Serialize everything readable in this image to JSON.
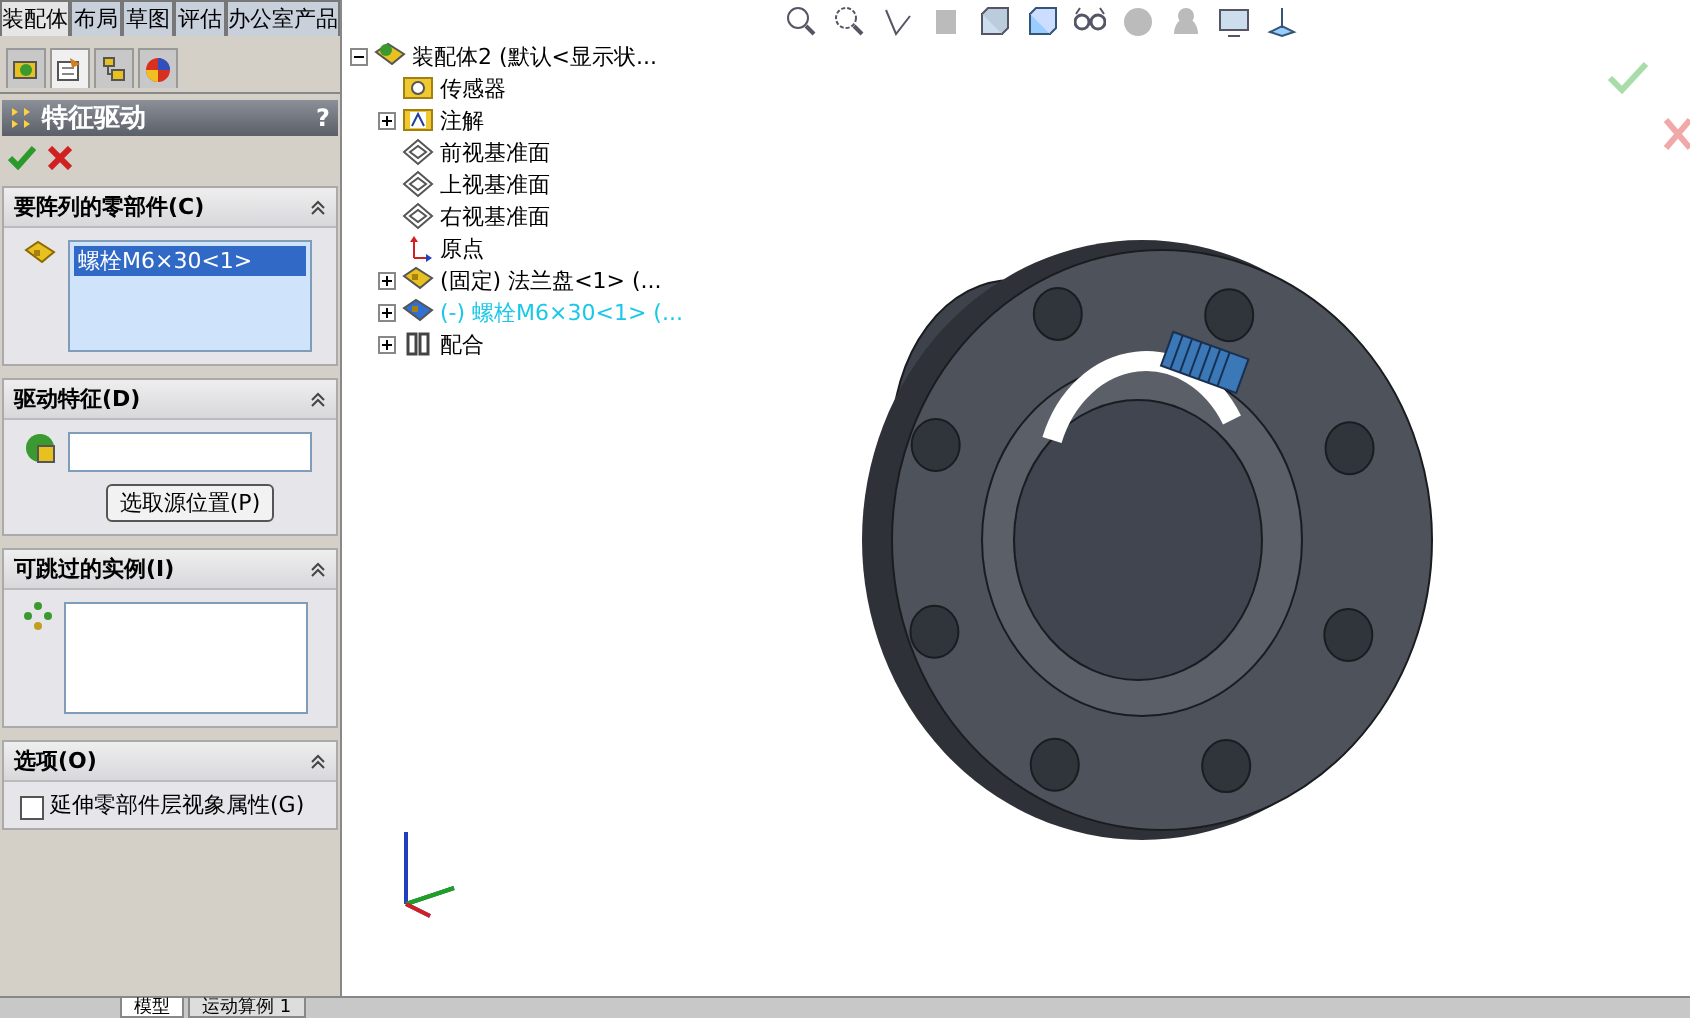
{
  "top_tabs": [
    {
      "label": "装配体",
      "selected": true
    },
    {
      "label": "布局",
      "selected": false
    },
    {
      "label": "草图",
      "selected": false
    },
    {
      "label": "评估",
      "selected": false
    },
    {
      "label": "办公室产品",
      "selected": false
    }
  ],
  "panel_tabs": [
    {
      "kind": "feature",
      "selected": false
    },
    {
      "kind": "property",
      "selected": true
    },
    {
      "kind": "config",
      "selected": false
    },
    {
      "kind": "appearance",
      "selected": false
    }
  ],
  "property_manager": {
    "title": "特征驱动",
    "help": "?"
  },
  "sections": [
    {
      "kind": "list",
      "title": "要阵列的零部件(C)",
      "items": [
        "螺栓M6×30<1>"
      ]
    },
    {
      "kind": "field",
      "title": "驱动特征(D)",
      "button": "选取源位置(P)"
    },
    {
      "kind": "list",
      "title": "可跳过的实例(I)"
    },
    {
      "kind": "checkbox",
      "title": "选项(O)",
      "label": "延伸零部件层视象属性(G)",
      "checked": false
    }
  ],
  "tree": {
    "label": "装配体2  (默认<显示状...",
    "kind": "assembly",
    "expanded": true,
    "children": [
      {
        "label": "传感器",
        "kind": "sensor"
      },
      {
        "label": "注解",
        "kind": "annotation",
        "expanded": false
      },
      {
        "label": "前视基准面",
        "kind": "plane"
      },
      {
        "label": "上视基准面",
        "kind": "plane"
      },
      {
        "label": "右视基准面",
        "kind": "plane"
      },
      {
        "label": "原点",
        "kind": "origin"
      },
      {
        "label": "(固定) 法兰盘<1> (...",
        "kind": "part",
        "expanded": false,
        "highlighted": false
      },
      {
        "label": "(-) 螺栓M6×30<1> (...",
        "kind": "part",
        "expanded": false,
        "highlighted": true
      },
      {
        "label": "配合",
        "kind": "mate",
        "expanded": false
      }
    ]
  },
  "bottom_tabs": [
    {
      "label": "模型",
      "selected": true
    },
    {
      "label": "运动算例 1",
      "selected": false
    }
  ]
}
